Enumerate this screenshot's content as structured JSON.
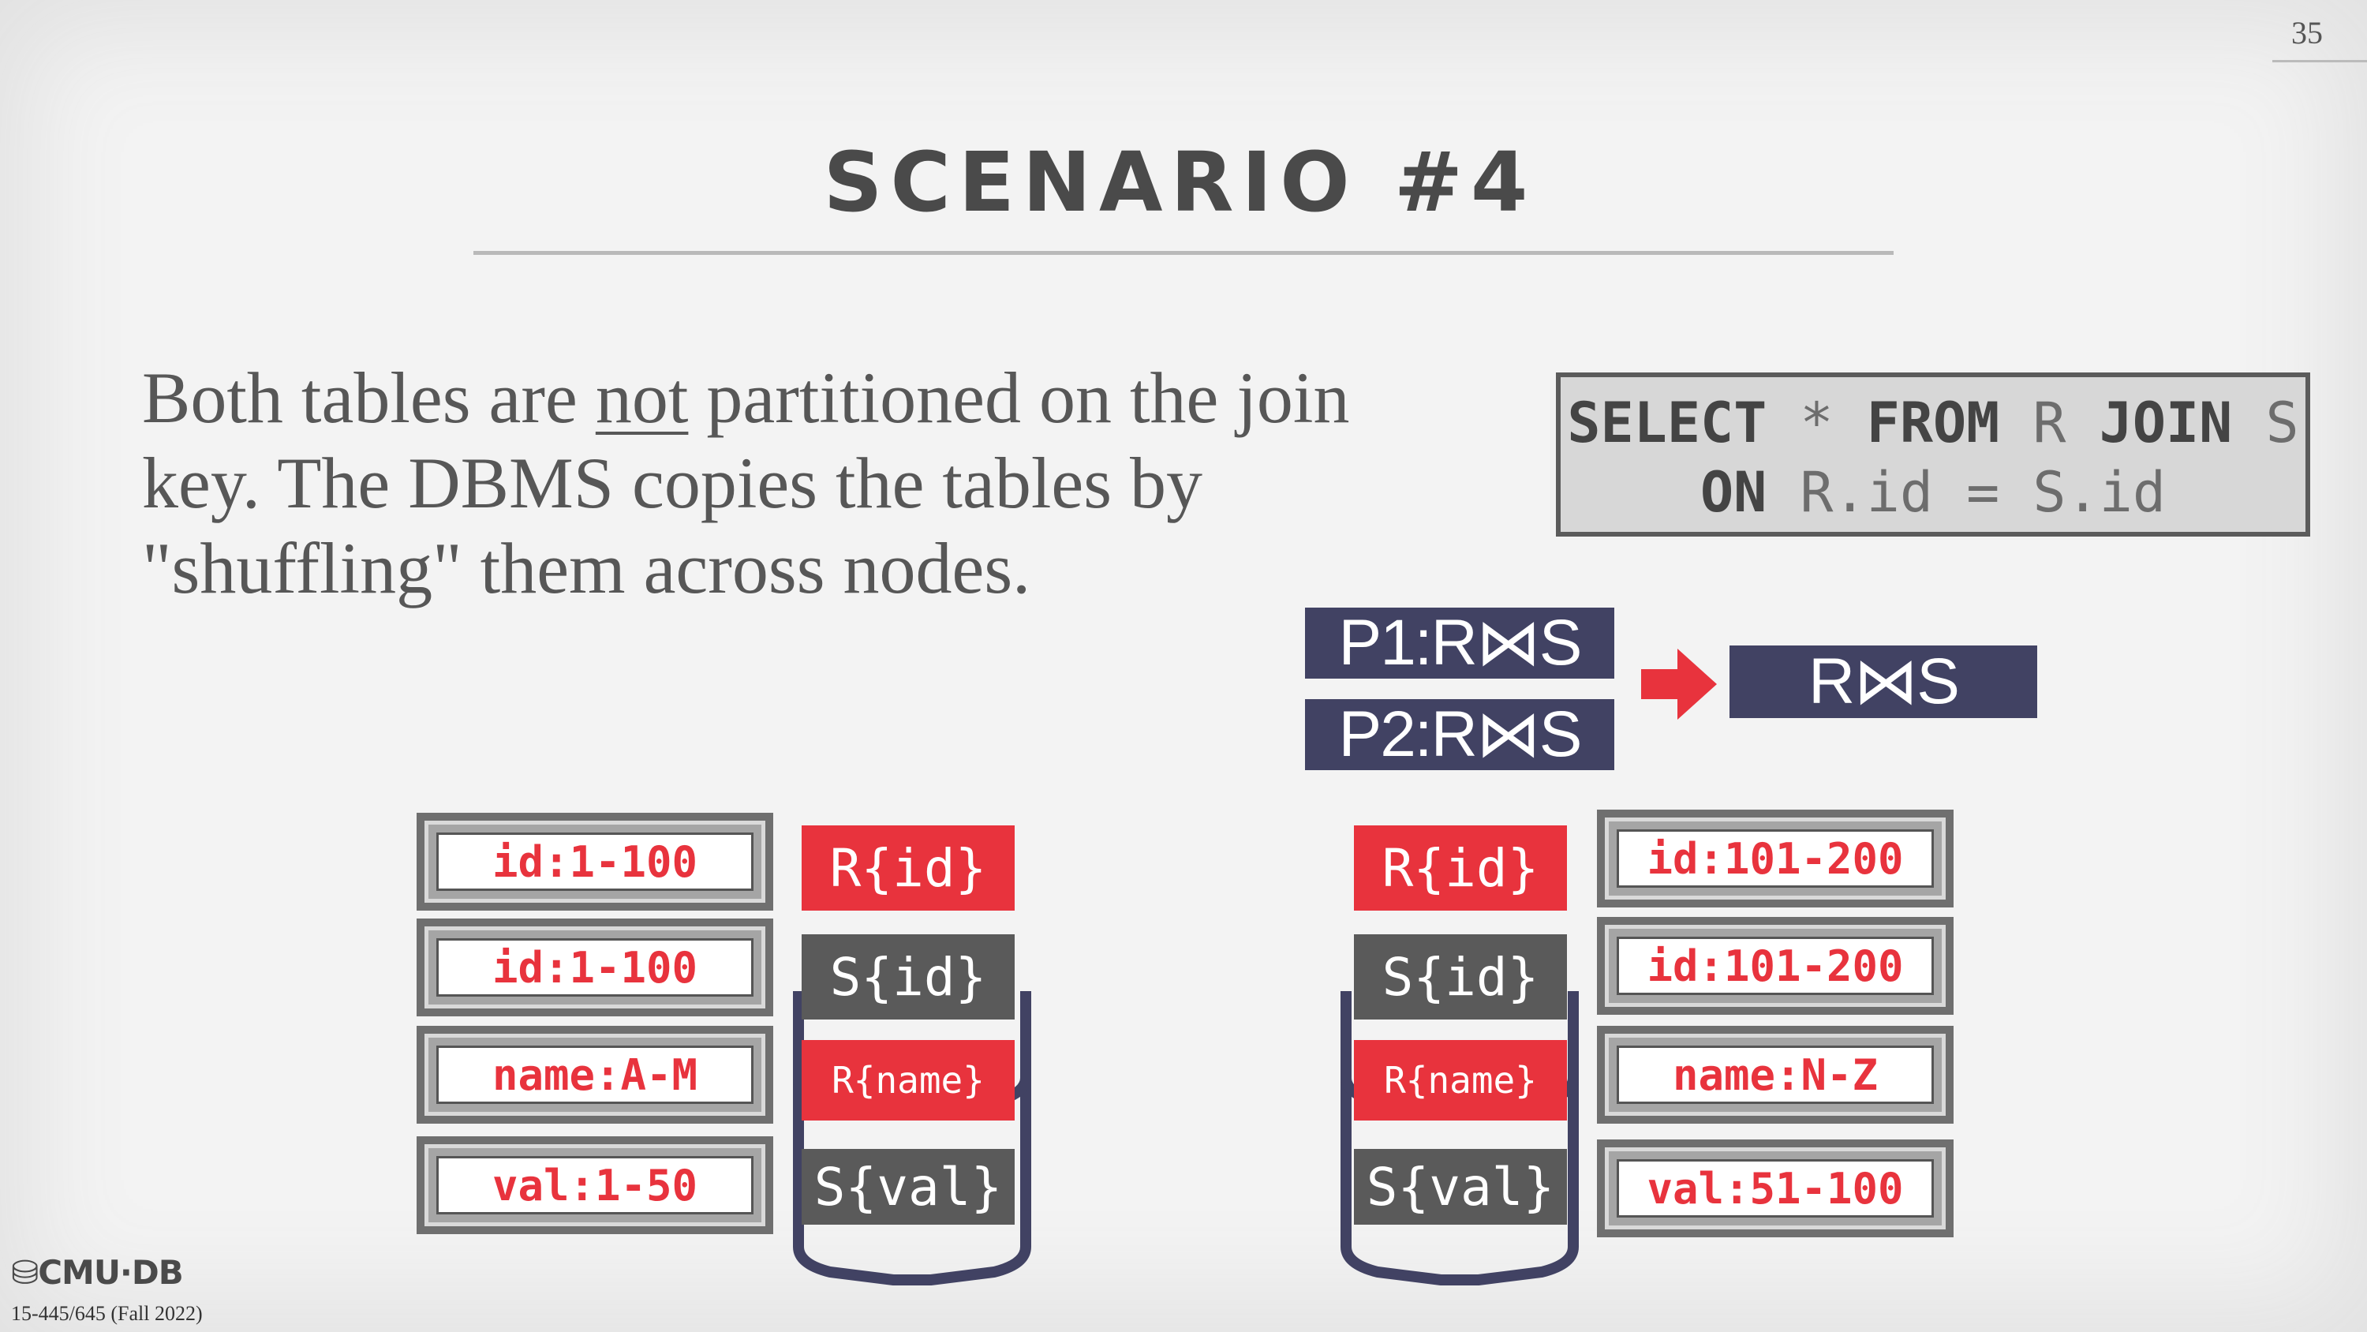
{
  "slide": {
    "page_number": "35",
    "title": "SCENARIO #4",
    "body_pre": "Both tables are ",
    "body_underline": "not",
    "body_post": " partitioned on the join key. The DBMS copies the tables by \"shuffling\" them across nodes."
  },
  "sql": {
    "kw_select": "SELECT",
    "star": " * ",
    "kw_from": "FROM",
    "rel_r": " R ",
    "kw_join": "JOIN",
    "rel_s": " S",
    "kw_on": "ON",
    "cond": " R.id = S.id"
  },
  "results": {
    "p1": "P1:R⋈S",
    "p2": "P2:R⋈S",
    "final": "R⋈S"
  },
  "left_node": {
    "partitions": [
      "id:1-100",
      "id:1-100",
      "name:A-M",
      "val:1-50"
    ],
    "chips": [
      "R{id}",
      "S{id}",
      "R{name}",
      "S{val}"
    ]
  },
  "right_node": {
    "partitions": [
      "id:101-200",
      "id:101-200",
      "name:N-Z",
      "val:51-100"
    ],
    "chips": [
      "R{id}",
      "S{id}",
      "R{name}",
      "S{val}"
    ]
  },
  "footer": {
    "logo": "CMU·DB",
    "course": "15-445/645 (Fall 2022)"
  },
  "colors": {
    "accent_red": "#e8333d",
    "navy": "#414263",
    "chip_gray": "#5a5a5a"
  }
}
